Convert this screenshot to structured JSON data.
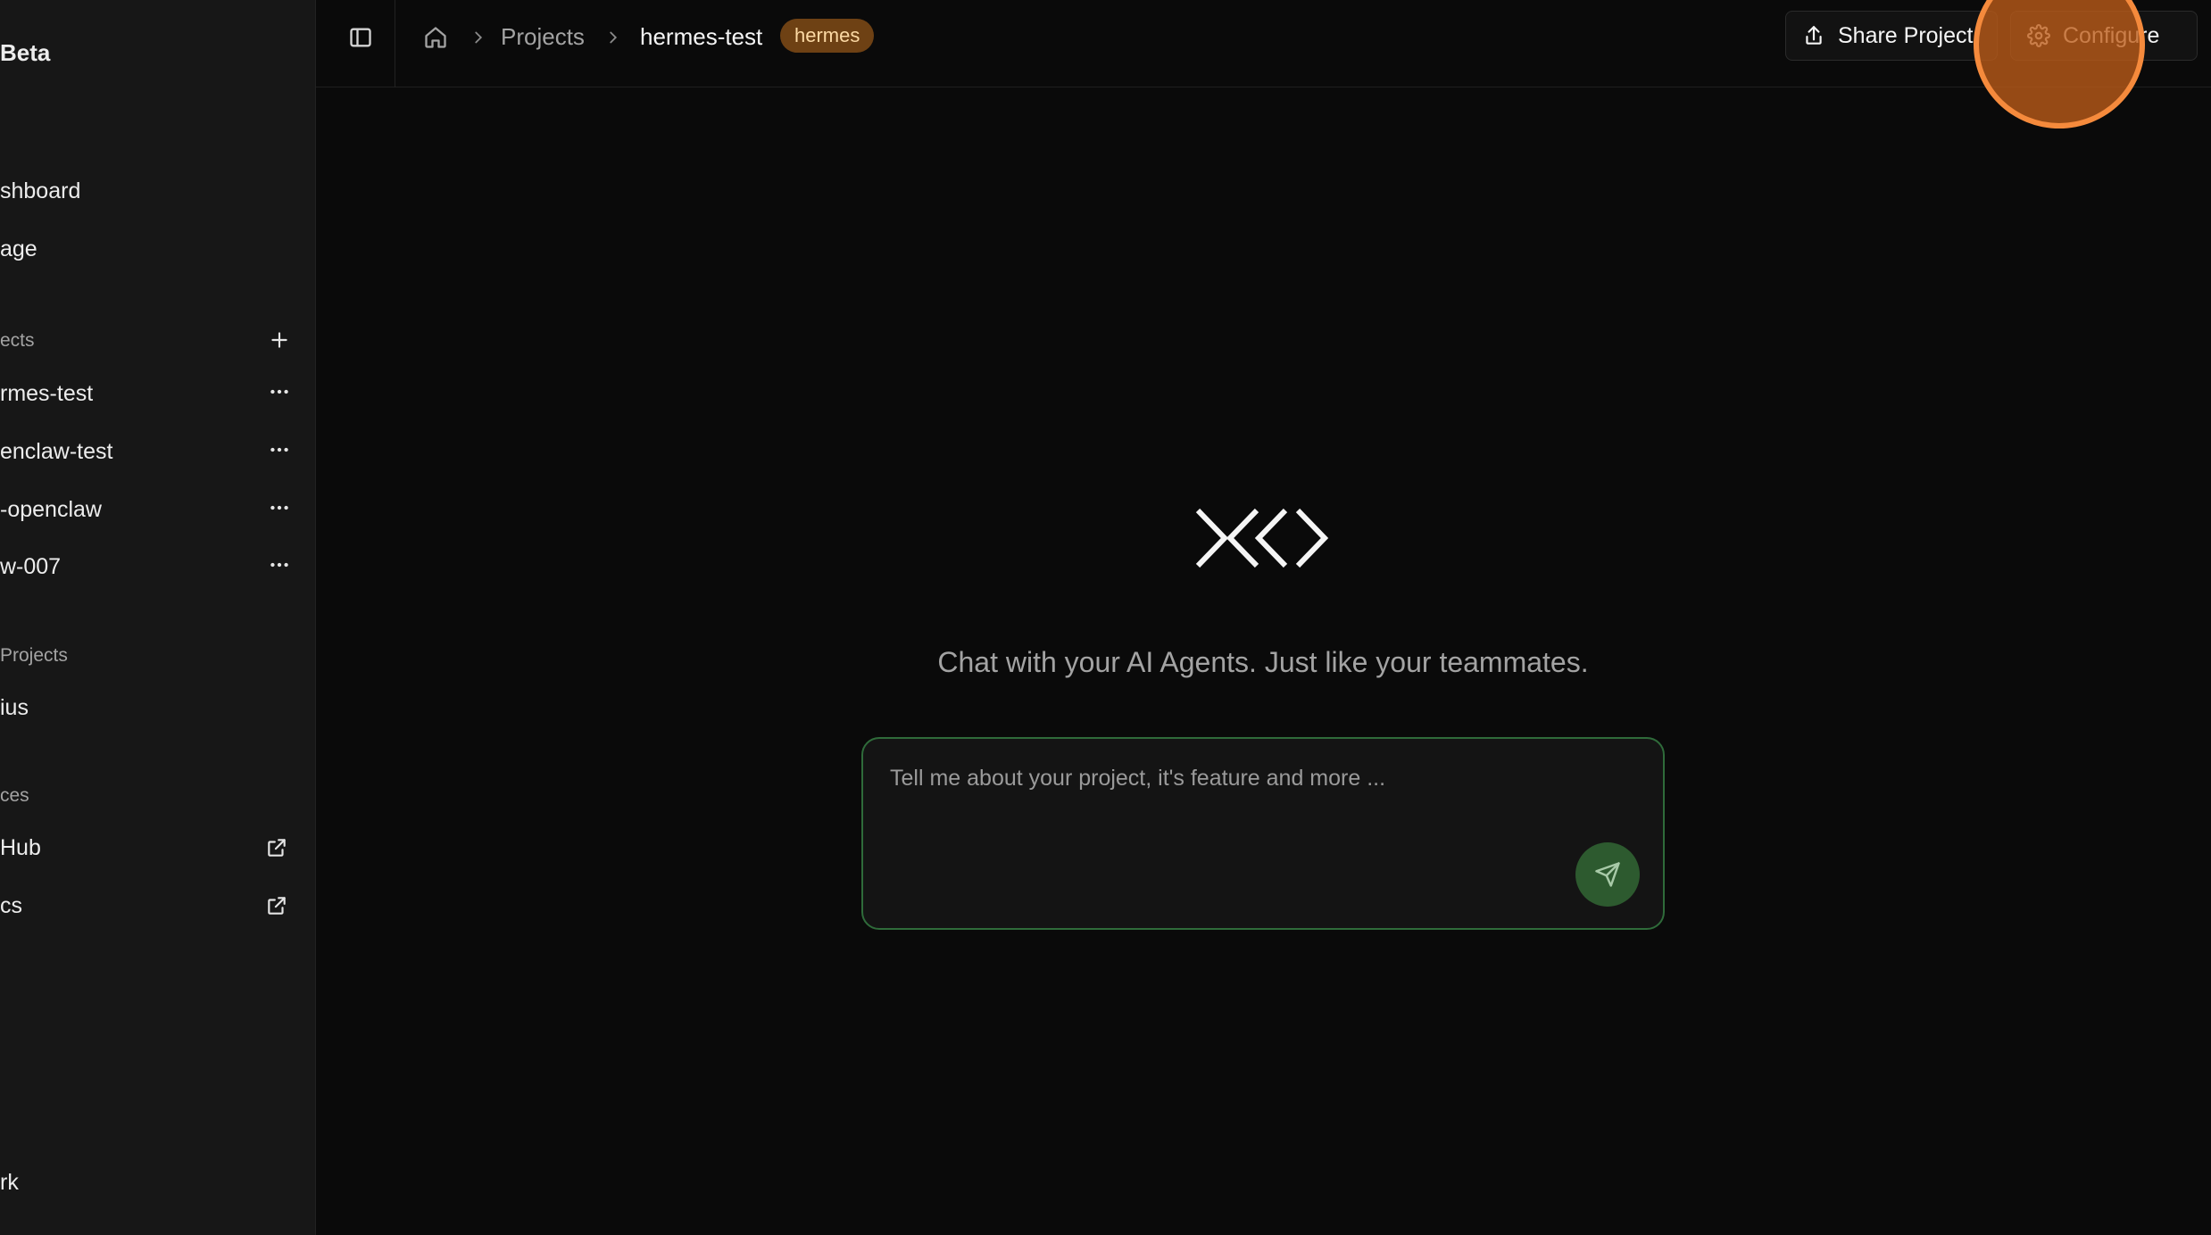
{
  "sidebar": {
    "brand": "Beta",
    "nav": [
      {
        "label": "shboard"
      },
      {
        "label": "age"
      }
    ],
    "projects_heading": "ects",
    "projects": [
      {
        "label": "rmes-test"
      },
      {
        "label": "enclaw-test"
      },
      {
        "label": "-openclaw"
      },
      {
        "label": "w-007"
      }
    ],
    "shared_heading": "Projects",
    "shared_projects": [
      {
        "label": "ius"
      }
    ],
    "resources_heading": "ces",
    "resources": [
      {
        "label": "Hub"
      },
      {
        "label": "cs"
      }
    ],
    "footer_label": "rk"
  },
  "header": {
    "breadcrumb": {
      "projects": "Projects",
      "current": "hermes-test",
      "badge": "hermes"
    },
    "share_label": "Share Project",
    "configure_label": "Configure"
  },
  "main": {
    "tagline": "Chat with your AI Agents. Just like your teammates.",
    "chat_placeholder": "Tell me about your project, it's feature and more ..."
  },
  "colors": {
    "accent_green": "#2f6b3a",
    "badge_bg": "#6e4114",
    "highlight": "#f58a3c"
  }
}
